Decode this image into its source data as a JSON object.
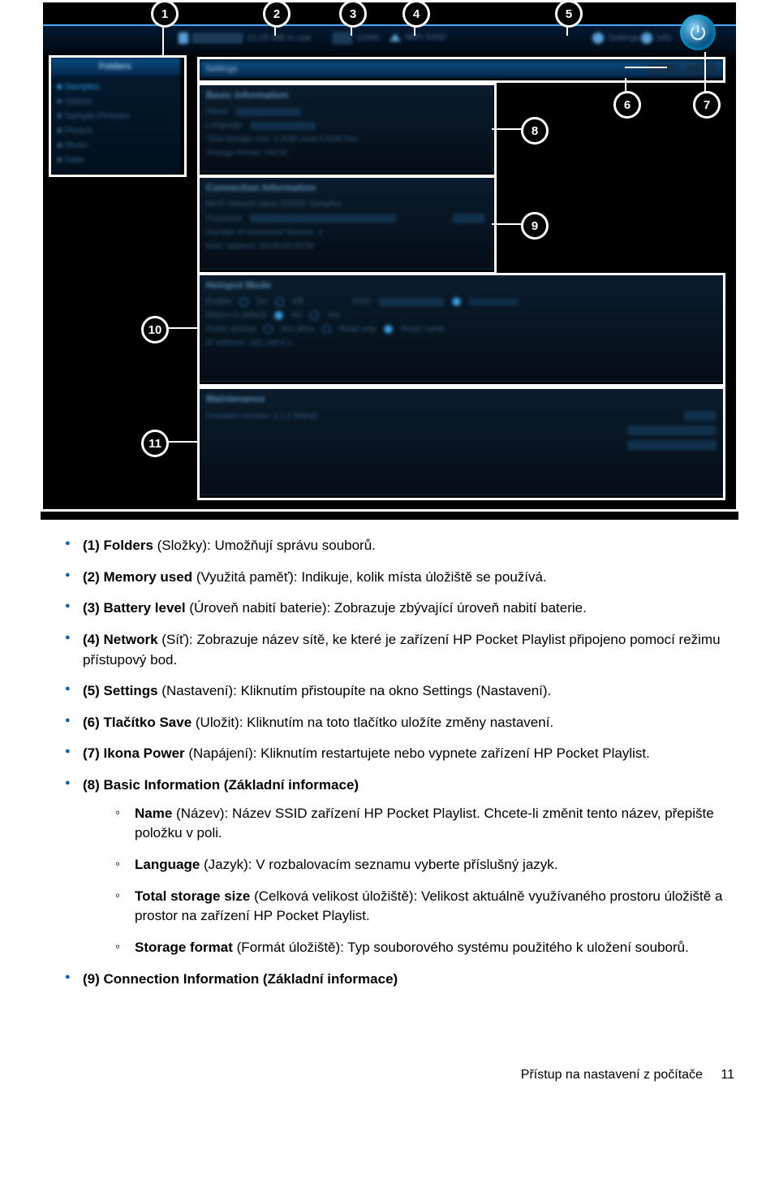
{
  "callouts": {
    "c1": "1",
    "c2": "2",
    "c3": "3",
    "c4": "4",
    "c5": "5",
    "c6": "6",
    "c7": "7",
    "c8": "8",
    "c9": "9",
    "c10": "10",
    "c11": "11"
  },
  "ui": {
    "topbar": {
      "storage_text": "10.25 MB in use",
      "battery_text": "100%",
      "wifi_text": "WiFi SSID",
      "settings_label": "Settings",
      "info_label": "Info"
    },
    "sidebar": {
      "header": "Folders",
      "items": [
        "■ Samples",
        "■ Videos",
        "■ Sample Pictures",
        "■ Photos",
        "■ Music",
        "■ Data"
      ]
    },
    "settings_header": "Settings",
    "box8": {
      "title": "Basic Information",
      "name_label": "Name",
      "lang_label": "Language",
      "size_label": "Total storage size: 1.0GB used 3.4GB free",
      "fmt_label": "Storage format: FAT32"
    },
    "box9": {
      "title": "Connection Information",
      "ssid_label": "Wi-Fi network name (SSID): Samples",
      "pwd_label": "Password",
      "num_label": "Number of connected devices: 1",
      "mac_label": "MAC address: 00:00:00:00:00"
    },
    "box10": {
      "title": "Hotspot Mode",
      "row1": "Enable",
      "row2": "Return to default",
      "row3": "Public access",
      "row4": "IP address: 192.168.5.1"
    },
    "box11": {
      "title": "Maintenance",
      "row1": "Firmware version: 1.1.1 (latest)"
    }
  },
  "list": {
    "l1a": "(1) Folders",
    "l1b": " (Složky): Umožňují správu souborů.",
    "l2a": "(2) Memory used",
    "l2b": " (Využitá paměť): Indikuje, kolik místa úložiště se používá.",
    "l3a": "(3) Battery level",
    "l3b": " (Úroveň nabití baterie): Zobrazuje zbývající úroveň nabití baterie.",
    "l4a": "(4) Network",
    "l4b": " (Síť): Zobrazuje název sítě, ke které je zařízení HP Pocket Playlist připojeno pomocí režimu přístupový bod.",
    "l5a": "(5) Settings",
    "l5b": " (Nastavení): Kliknutím přistoupíte na okno Settings (Nastavení).",
    "l6a": "(6) Tlačítko Save",
    "l6b": " (Uložit): Kliknutím na toto tlačítko uložíte změny nastavení.",
    "l7a": "(7) Ikona Power",
    "l7b": " (Napájení): Kliknutím restartujete nebo vypnete zařízení HP Pocket Playlist.",
    "l8a": "(8) Basic Information (Základní informace)",
    "l8_1a": "Name",
    "l8_1b": " (Název): Název SSID zařízení HP Pocket Playlist. Chcete-li změnit tento název, přepište položku v poli.",
    "l8_2a": "Language",
    "l8_2b": " (Jazyk): V rozbalovacím seznamu vyberte příslušný jazyk.",
    "l8_3a": "Total storage size",
    "l8_3b": " (Celková velikost úložiště): Velikost aktuálně využívaného prostoru úložiště a prostor na zařízení HP Pocket Playlist.",
    "l8_4a": "Storage format",
    "l8_4b": " (Formát úložiště): Typ souborového systému použitého k uložení souborů.",
    "l9a": "(9) Connection Information (Základní informace)"
  },
  "footer": {
    "label": "Přístup na nastavení z počítače",
    "page": "11"
  }
}
